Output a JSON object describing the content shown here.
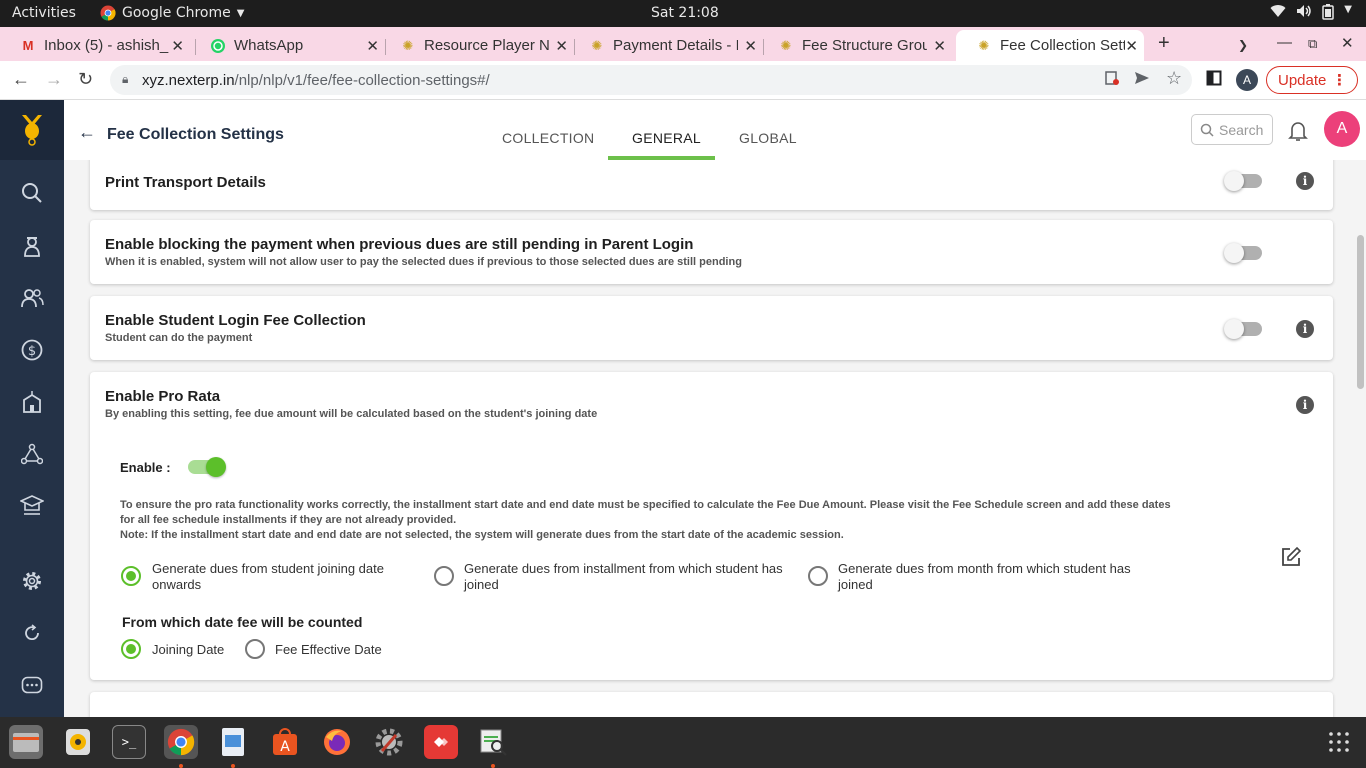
{
  "system_bar": {
    "activities": "Activities",
    "app_name": "Google Chrome",
    "clock": "Sat 21:08"
  },
  "browser": {
    "tabs": [
      {
        "label": "Inbox (5) - ashish_",
        "icon": "gmail-icon"
      },
      {
        "label": "WhatsApp",
        "icon": "whatsapp-icon"
      },
      {
        "label": "Resource Player N",
        "icon": "nexterp-icon"
      },
      {
        "label": "Payment Details - I",
        "icon": "nexterp-icon"
      },
      {
        "label": "Fee Structure Grou",
        "icon": "nexterp-icon"
      },
      {
        "label": "Fee Collection Setti",
        "icon": "nexterp-icon",
        "active": true
      }
    ],
    "url_host": "xyz.nexterp.in",
    "url_path": "/nlp/nlp/v1/fee/fee-collection-settings#/",
    "profile_initial": "A",
    "update_label": "Update"
  },
  "app": {
    "page_title": "Fee Collection Settings",
    "tabs": [
      "COLLECTION",
      "GENERAL",
      "GLOBAL"
    ],
    "active_tab": "GENERAL",
    "search_placeholder": "Search",
    "avatar_initial": "A",
    "accent_color": "#6cc04a"
  },
  "settings": {
    "print_transport": {
      "title": "Print Transport Details",
      "enabled": false
    },
    "block_payment": {
      "title": "Enable blocking the payment when previous dues are still pending in Parent Login",
      "subtitle": "When it is enabled, system will not allow user to pay the selected dues if previous to those selected dues are still pending",
      "enabled": false
    },
    "student_login": {
      "title": "Enable Student Login Fee Collection",
      "subtitle": "Student can do the payment",
      "enabled": false
    },
    "pro_rata": {
      "title": "Enable Pro Rata",
      "subtitle": "By enabling this setting, fee due amount will be calculated based on the student's joining date",
      "enable_label": "Enable :",
      "enabled": true,
      "note_line1": "To ensure the pro rata functionality works correctly, the installment start date and end date must be specified to calculate the Fee Due Amount. Please visit the Fee Schedule screen and add these dates for all fee schedule installments if they are not already provided.",
      "note_line2": "Note: If the installment start date and end date are not selected, the system will generate dues from the start date of the academic session.",
      "generate_options": [
        "Generate dues from student joining date onwards",
        "Generate dues from installment from which student has joined",
        "Generate dues from month from which student has joined"
      ],
      "generate_selected": 0,
      "date_heading": "From which date fee will be counted",
      "date_options": [
        "Joining Date",
        "Fee Effective Date"
      ],
      "date_selected": 0
    }
  }
}
